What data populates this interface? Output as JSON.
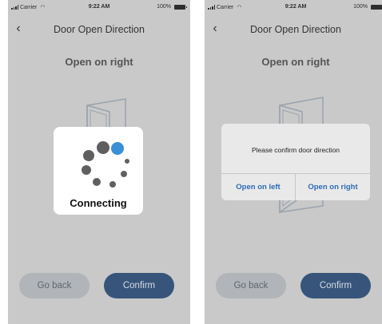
{
  "status_bar": {
    "carrier": "Carrier",
    "time": "9:22 AM",
    "battery": "100%"
  },
  "screens": [
    {
      "nav_title": "Door Open Direction",
      "heading": "Open on right",
      "buttons": {
        "back": "Go back",
        "confirm": "Confirm"
      },
      "loading": {
        "text": "Connecting"
      }
    },
    {
      "nav_title": "Door Open Direction",
      "heading": "Open on right",
      "buttons": {
        "back": "Go back",
        "confirm": "Confirm"
      },
      "dialog": {
        "message": "Please confirm door direction",
        "left_button": "Open on left",
        "right_button": "Open on right"
      }
    }
  ],
  "colors": {
    "dim_background": "#c9c9c9",
    "confirm_button": "#37557a",
    "go_back_button": "#b1b4b8",
    "dialog_button_text": "#2c6bb5",
    "spinner_accent": "#3a8fd6"
  },
  "icons": [
    "signal-icon",
    "wifi-icon",
    "battery-icon",
    "back-chevron-icon",
    "door-icon",
    "spinner-icon"
  ]
}
